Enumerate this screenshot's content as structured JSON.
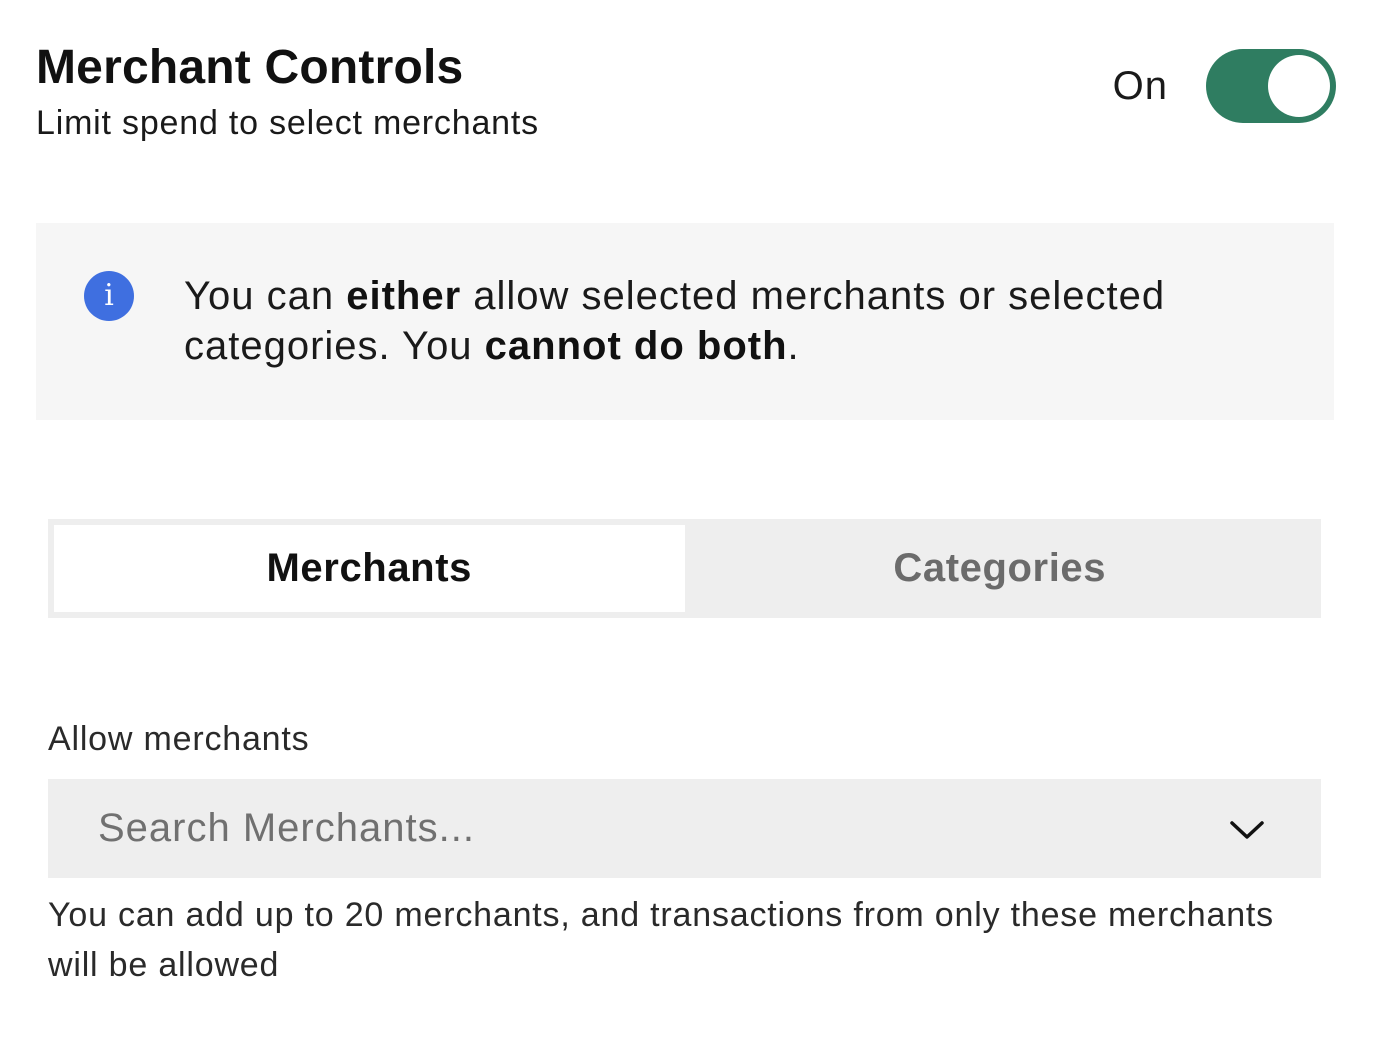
{
  "header": {
    "title": "Merchant Controls",
    "subtitle": "Limit spend to select merchants",
    "toggle_label": "On",
    "toggle_on": true
  },
  "info": {
    "icon": "info-icon",
    "icon_glyph": "i",
    "text_part1": "You can ",
    "text_bold1": "either",
    "text_part2": " allow selected merchants or selected categories. You ",
    "text_bold2": "cannot do both",
    "text_part3": "."
  },
  "tabs": [
    {
      "label": "Merchants",
      "active": true
    },
    {
      "label": "Categories",
      "active": false
    }
  ],
  "merchant_field": {
    "label": "Allow merchants",
    "placeholder": "Search Merchants...",
    "value": "",
    "dropdown_icon": "chevron-down-icon",
    "help_text": "You can add up to 20 merchants, and transactions from only these merchants will be allowed"
  },
  "colors": {
    "toggle_on": "#2f7d61",
    "info_icon": "#3f6fe0",
    "info_background": "#f6f6f6",
    "tab_background": "#eeeeee",
    "inactive_tab_text": "#6b6b6b"
  }
}
